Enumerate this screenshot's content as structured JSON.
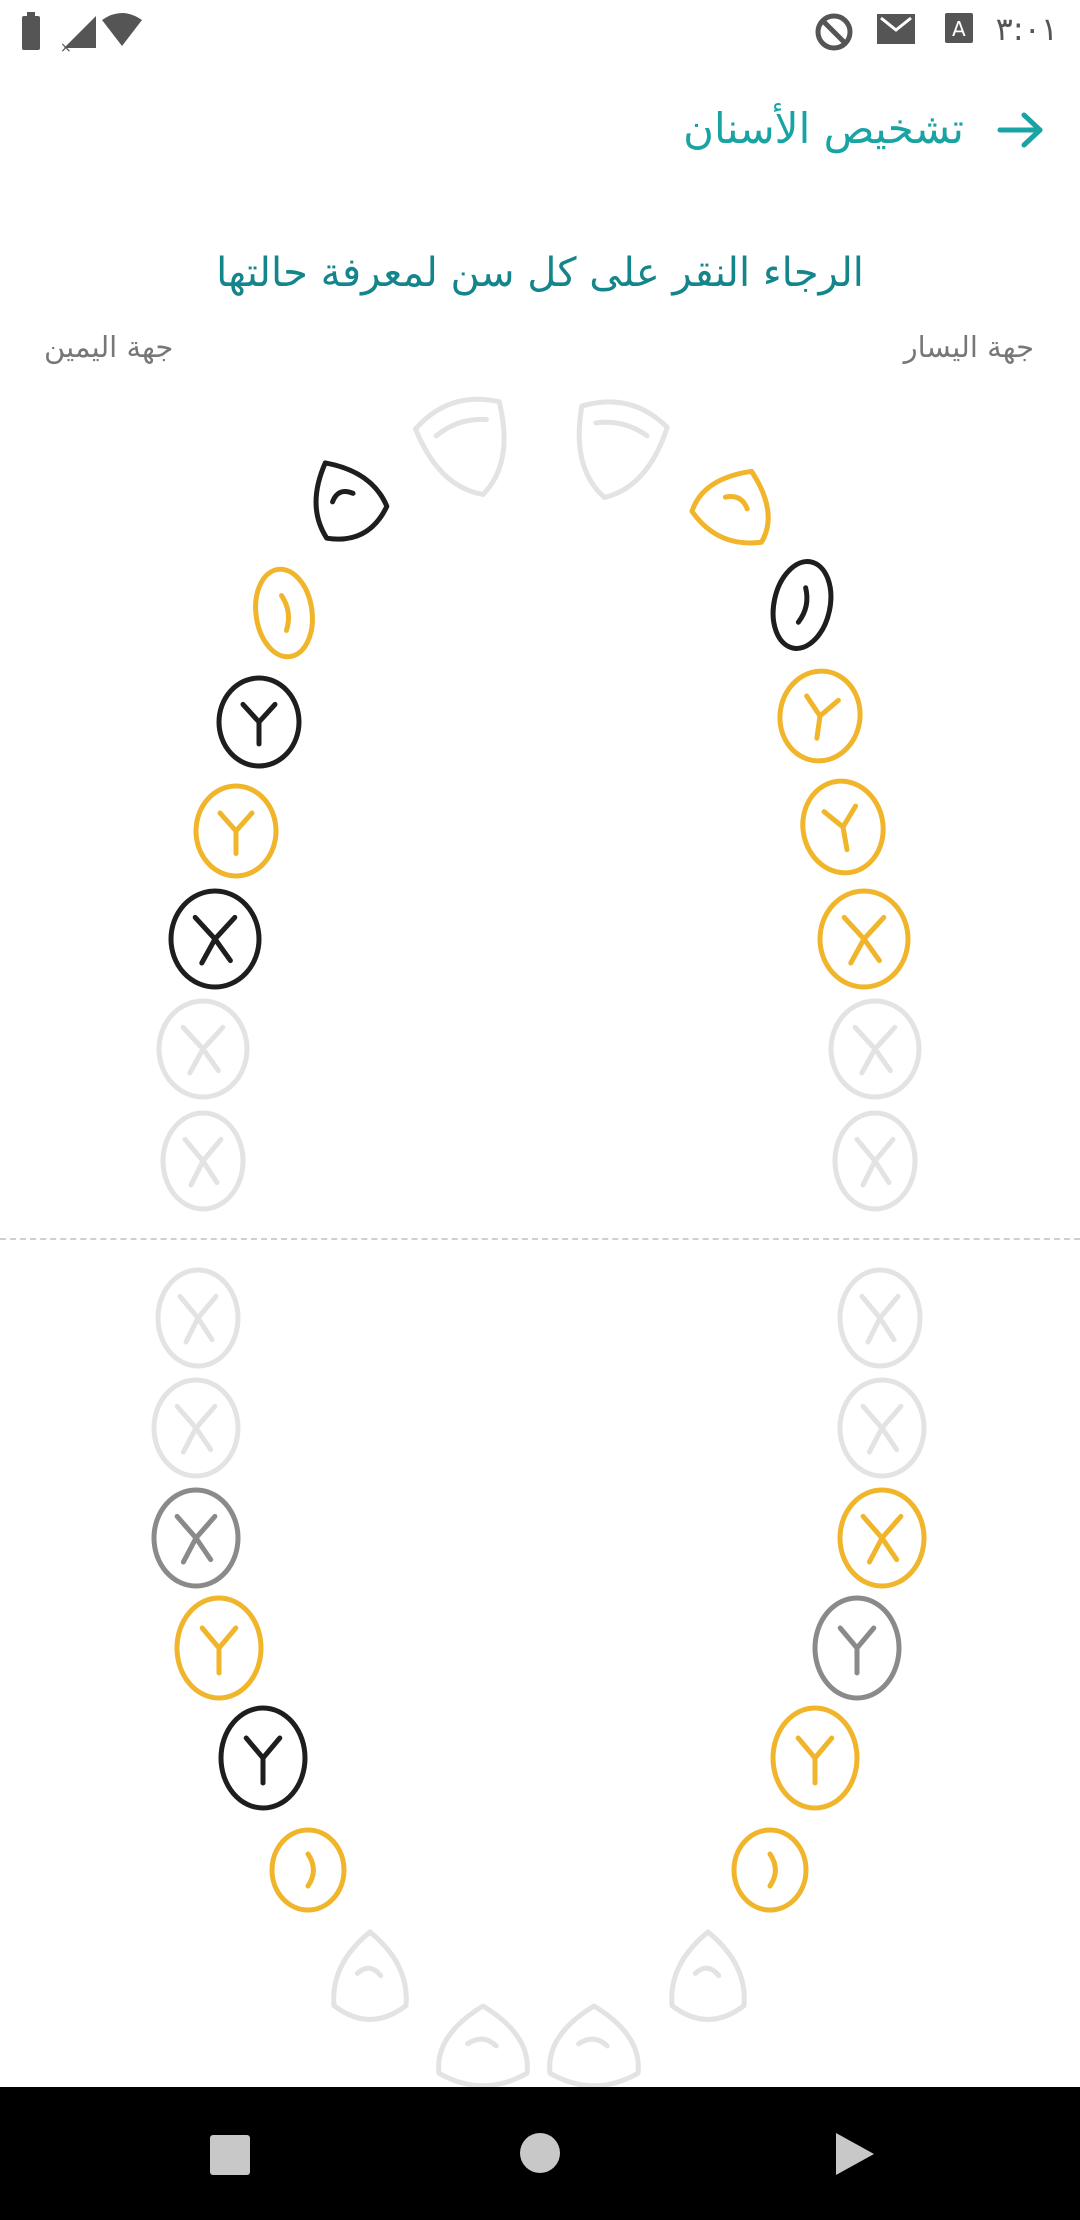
{
  "status_bar": {
    "time": "٣:٠١",
    "icons": [
      "battery-icon",
      "no-signal-icon",
      "wifi-icon",
      "sync-icon",
      "gmail-icon",
      "keyboard-a-icon"
    ]
  },
  "header": {
    "title": "تشخيص الأسنان",
    "back_icon": "arrow-right-icon"
  },
  "instruction": "الرجاء النقر على كل سن لمعرفة حالتها",
  "sides": {
    "left_side_label": "جهة اليسار",
    "right_side_label": "جهة اليمين"
  },
  "colors": {
    "yellow": "#f0b52a",
    "black": "#1e1e1e",
    "gray": "#8a8a8a",
    "light": "#e3e3e3",
    "accent": "#1aa3a3"
  },
  "teeth_status": {
    "upper": [
      "light",
      "light",
      "black",
      "yellow",
      "yellow",
      "black",
      "black",
      "yellow",
      "yellow",
      "yellow",
      "black",
      "yellow",
      "light",
      "light",
      "light",
      "light"
    ],
    "lower": [
      "light",
      "light",
      "light",
      "light",
      "gray",
      "yellow",
      "yellow",
      "gray",
      "black",
      "yellow",
      "yellow",
      "yellow",
      "light",
      "light"
    ]
  },
  "nav_bar": {
    "icons": [
      "recents-square-icon",
      "home-circle-icon",
      "back-triangle-icon"
    ]
  }
}
